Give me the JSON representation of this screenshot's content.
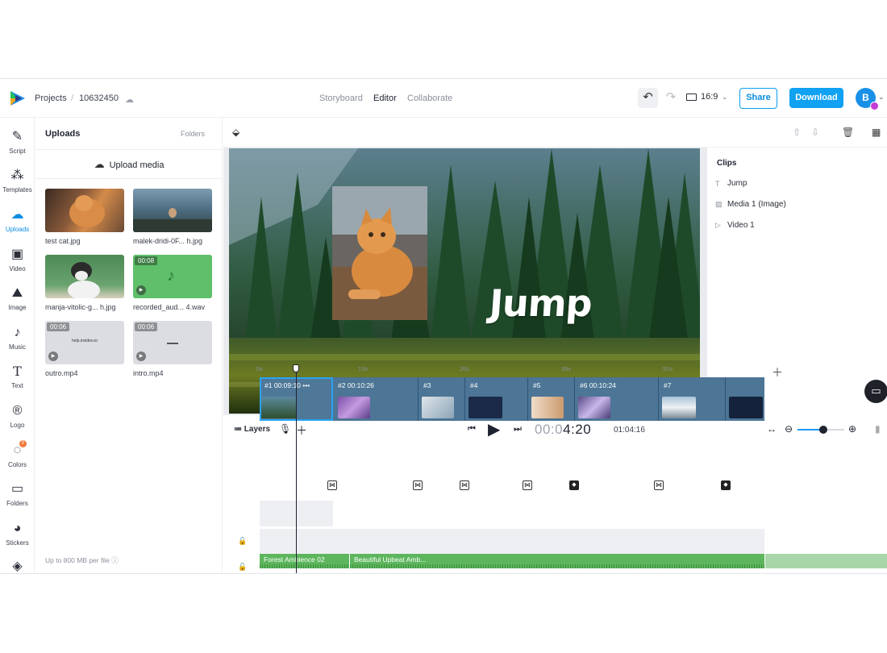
{
  "header": {
    "breadcrumb_projects": "Projects",
    "breadcrumb_sep": "/",
    "project_id": "10632450",
    "nav_tabs": [
      "Storyboard",
      "Editor",
      "Collaborate"
    ],
    "active_tab": "Editor",
    "aspect_ratio": "16:9",
    "share_label": "Share",
    "download_label": "Download",
    "avatar_initial": "B"
  },
  "sidebar": {
    "items": [
      {
        "label": "Script",
        "icon": "script-icon"
      },
      {
        "label": "Templates",
        "icon": "templates-icon"
      },
      {
        "label": "Uploads",
        "icon": "uploads-icon"
      },
      {
        "label": "Video",
        "icon": "video-icon"
      },
      {
        "label": "Image",
        "icon": "image-icon"
      },
      {
        "label": "Music",
        "icon": "music-icon"
      },
      {
        "label": "Text",
        "icon": "text-icon"
      },
      {
        "label": "Logo",
        "icon": "logo-icon"
      },
      {
        "label": "Colors",
        "icon": "colors-icon"
      },
      {
        "label": "Folders",
        "icon": "folders-icon"
      },
      {
        "label": "Stickers",
        "icon": "stickers-icon"
      }
    ],
    "colors_badge": "0"
  },
  "uploads": {
    "title": "Uploads",
    "folders_link": "Folders",
    "upload_button": "Upload media",
    "files": [
      {
        "name": "test cat.jpg"
      },
      {
        "name": "malek-dridi-0F... h.jpg"
      },
      {
        "name": "manja-vitolic-g... h.jpg"
      },
      {
        "name": "recorded_aud... 4.wav",
        "duration": "00:08"
      },
      {
        "name": "outro.mp4",
        "duration": "00:06",
        "caption": "help.invideo.io"
      },
      {
        "name": "intro.mp4",
        "duration": "00:06"
      }
    ],
    "footer": "Up to 800 MB per file"
  },
  "canvas": {
    "text_overlay": "Jump"
  },
  "clips_panel": {
    "title": "Clips",
    "items": [
      "Jump",
      "Media 1 (Image)",
      "Video 1"
    ]
  },
  "timeline": {
    "layers_label": "Layers",
    "current_time_dim": "00:0",
    "current_time": "4:20",
    "total_time": "01:04:16",
    "zoom_level": 0.55,
    "ruler": [
      "0s",
      "13s",
      "26s",
      "39s",
      "52s"
    ],
    "segments": [
      {
        "label": "#1  00:09:10   •••"
      },
      {
        "label": "#2  00:10:26"
      },
      {
        "label": "#3"
      },
      {
        "label": "#4"
      },
      {
        "label": "#5"
      },
      {
        "label": "#6  00:10:24"
      },
      {
        "label": "#7"
      },
      {
        "label": ""
      }
    ],
    "audio": [
      {
        "label": "Forest Ambience 02"
      },
      {
        "label": "Beautiful Upbeat Amb..."
      }
    ]
  }
}
